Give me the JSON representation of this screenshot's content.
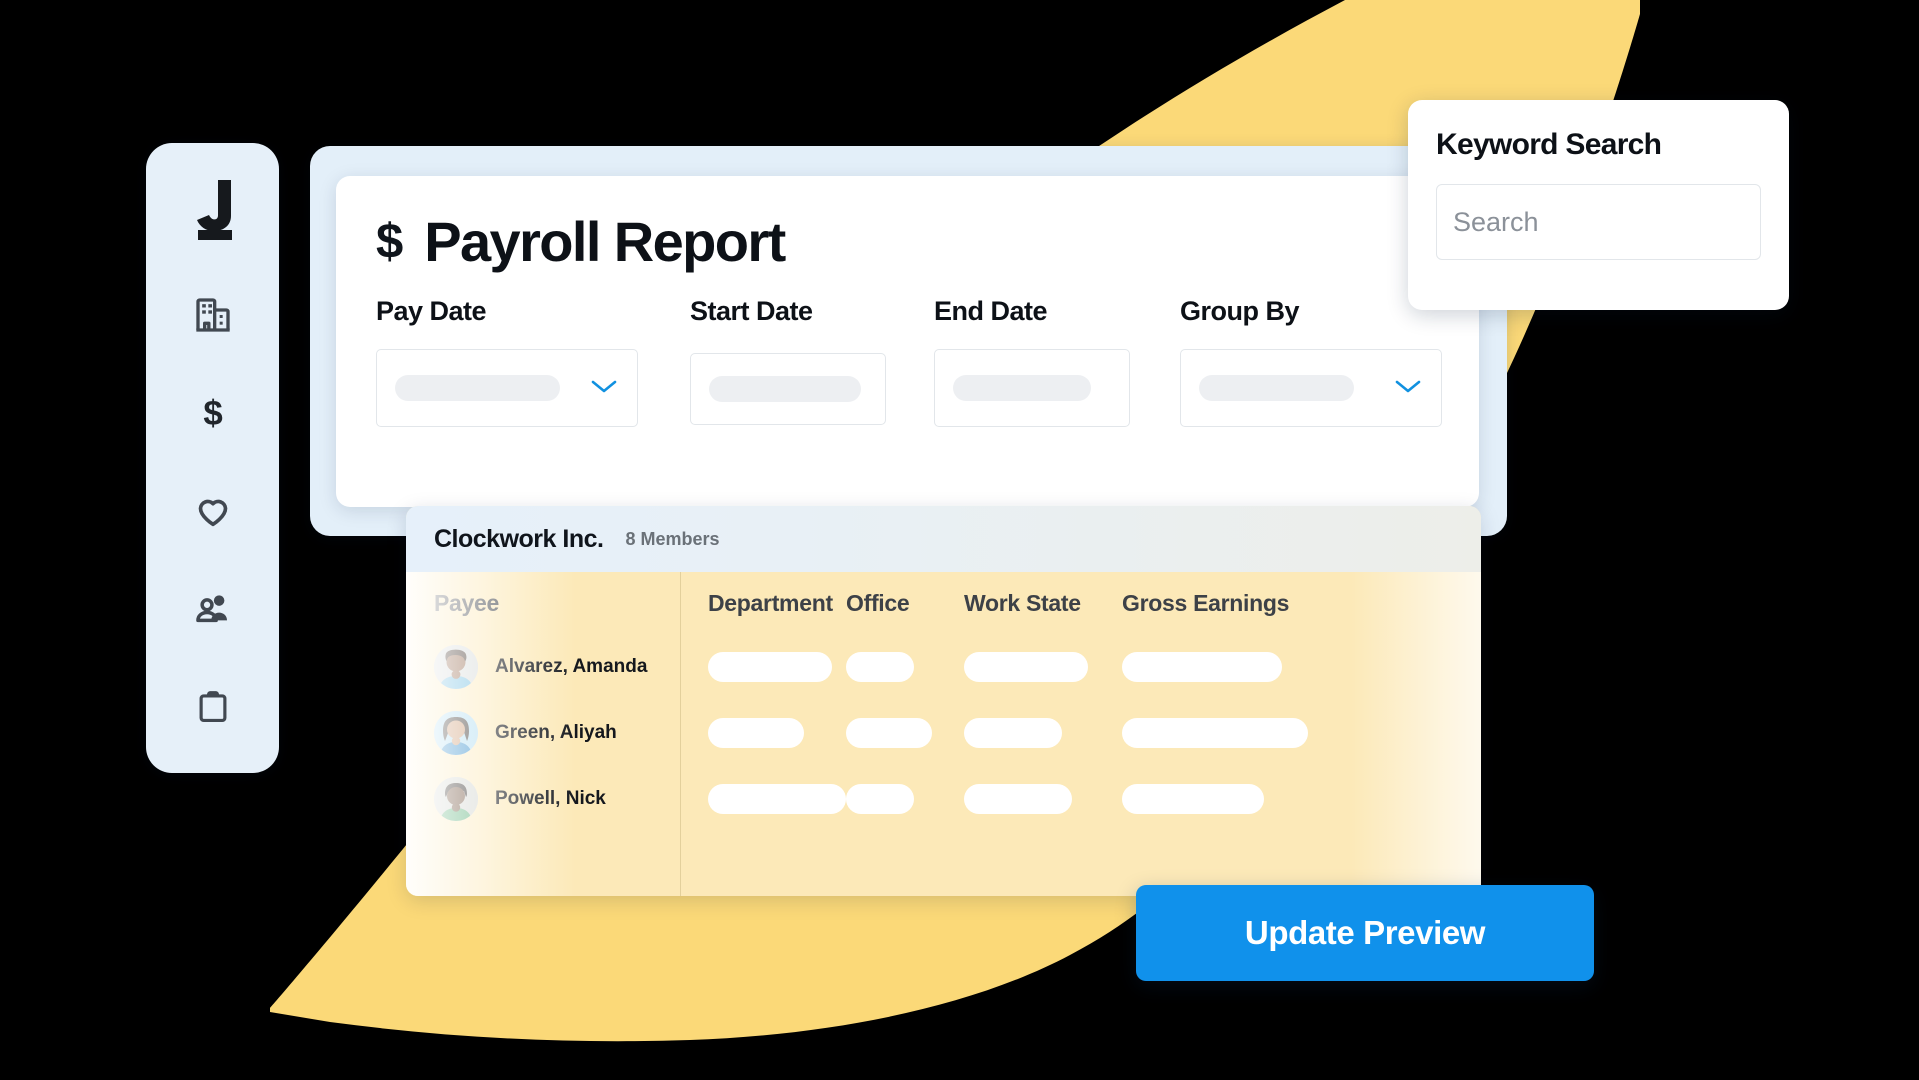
{
  "sidebar": {
    "logo": {
      "name": "justworks-j-logo",
      "letter": "J"
    },
    "items": [
      {
        "icon": "building-icon",
        "label": "Company"
      },
      {
        "icon": "dollar-icon",
        "label": "Payments"
      },
      {
        "icon": "heart-icon",
        "label": "Benefits"
      },
      {
        "icon": "people-icon",
        "label": "Team"
      },
      {
        "icon": "clipboard-icon",
        "label": "Documents"
      }
    ]
  },
  "report": {
    "currency_symbol": "$",
    "title": "Payroll Report",
    "filters": [
      {
        "label": "Pay Date",
        "value": "",
        "type": "select",
        "has_chevron": true
      },
      {
        "label": "Start Date",
        "value": "",
        "type": "date",
        "has_chevron": false
      },
      {
        "label": "End Date",
        "value": "",
        "type": "date",
        "has_chevron": false
      },
      {
        "label": "Group By",
        "value": "",
        "type": "select",
        "has_chevron": true
      }
    ]
  },
  "keyword_search": {
    "title": "Keyword Search",
    "placeholder": "Search",
    "value": ""
  },
  "table": {
    "company": "Clockwork Inc.",
    "members": "8 Members",
    "columns": [
      "Payee",
      "Department",
      "Office",
      "Work State",
      "Gross Earnings"
    ],
    "rows": [
      {
        "payee": "Alvarez, Amanda",
        "department": "",
        "office": "",
        "work_state": "",
        "gross_earnings": ""
      },
      {
        "payee": "Green, Aliyah",
        "department": "",
        "office": "",
        "work_state": "",
        "gross_earnings": ""
      },
      {
        "payee": "Powell, Nick",
        "department": "",
        "office": "",
        "work_state": "",
        "gross_earnings": ""
      }
    ]
  },
  "actions": {
    "update_preview": "Update Preview"
  },
  "colors": {
    "accent_blue": "#1091eb",
    "chevron_blue": "#1191e0",
    "sidebar_bg": "#e6f0f9",
    "backing_card": "#e3eff9",
    "blob_yellow": "#fbd978",
    "table_yellow": "#fce9b8",
    "canvas": "#000000"
  }
}
